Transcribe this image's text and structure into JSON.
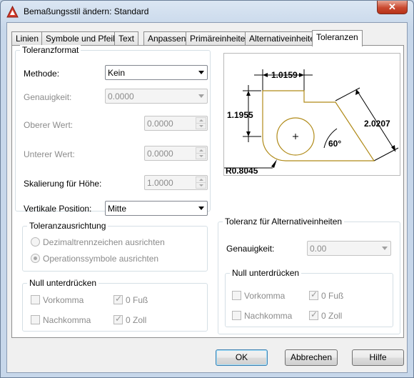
{
  "window": {
    "title": "Bemaßungsstil ändern: Standard",
    "close_label": "✕"
  },
  "tabs": [
    {
      "label": "Linien"
    },
    {
      "label": "Symbole und Pfeile"
    },
    {
      "label": "Text"
    },
    {
      "label": "Anpassen"
    },
    {
      "label": "Primäreinheiten"
    },
    {
      "label": "Alternativeinheiten"
    },
    {
      "label": "Toleranzen"
    }
  ],
  "active_tab": "Toleranzen",
  "toleranzformat": {
    "title": "Toleranzformat",
    "methode_label": "Methode:",
    "methode_value": "Kein",
    "genauigkeit_label": "Genauigkeit:",
    "genauigkeit_value": "0.0000",
    "oberer_label": "Oberer Wert:",
    "oberer_value": "0.0000",
    "unterer_label": "Unterer Wert:",
    "unterer_value": "0.0000",
    "skalierung_label": "Skalierung für Höhe:",
    "skalierung_value": "1.0000",
    "vertikal_label": "Vertikale Position:",
    "vertikal_value": "Mitte"
  },
  "ausrichtung": {
    "title": "Toleranzausrichtung",
    "option1": "Dezimaltrennzeichen ausrichten",
    "option2": "Operationssymbole ausrichten"
  },
  "null_left": {
    "title": "Null unterdrücken",
    "vorkomma": "Vorkomma",
    "fuss": "0 Fuß",
    "nachkomma": "Nachkomma",
    "zoll": "0 Zoll"
  },
  "alt": {
    "title": "Toleranz für Alternativeinheiten",
    "genauigkeit_label": "Genauigkeit:",
    "genauigkeit_value": "0.00"
  },
  "null_right": {
    "title": "Null unterdrücken",
    "vorkomma": "Vorkomma",
    "fuss": "0 Fuß",
    "nachkomma": "Nachkomma",
    "zoll": "0 Zoll"
  },
  "preview": {
    "dim_top": "1.0159",
    "dim_left": "1.1955",
    "dim_right": "2.0207",
    "angle": "60°",
    "radius": "R0.8045",
    "color_outline": "#b08a18"
  },
  "buttons": {
    "ok": "OK",
    "cancel": "Abbrechen",
    "help": "Hilfe"
  }
}
